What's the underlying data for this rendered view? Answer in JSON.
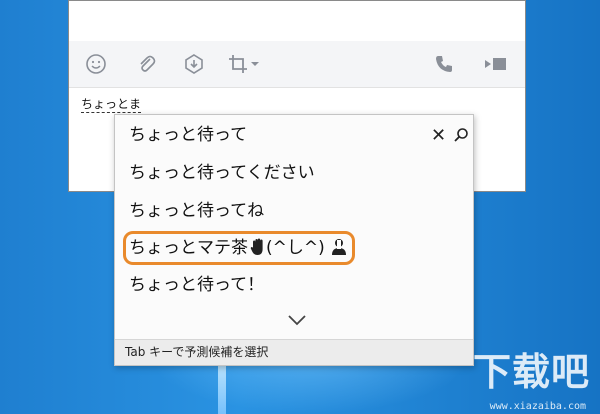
{
  "compose": {
    "text": "ちょっとま"
  },
  "toolbar": {
    "icons": [
      "smiley-icon",
      "paperclip-icon",
      "capture-download-icon",
      "crop-icon",
      "chevron-down-icon",
      "phone-icon",
      "video-icon"
    ]
  },
  "popup": {
    "candidates": [
      "ちょっと待って",
      "ちょっと待ってください",
      "ちょっと待ってね",
      "ちょっとマテ茶",
      "ちょっと待って！"
    ],
    "highlight_suffix": "(^し^)",
    "footer": "Tab キーで予測候補を選択",
    "accent": "#e98a2c"
  },
  "watermark": {
    "brand": "下载吧",
    "site": "www.xiazaiba.com"
  }
}
